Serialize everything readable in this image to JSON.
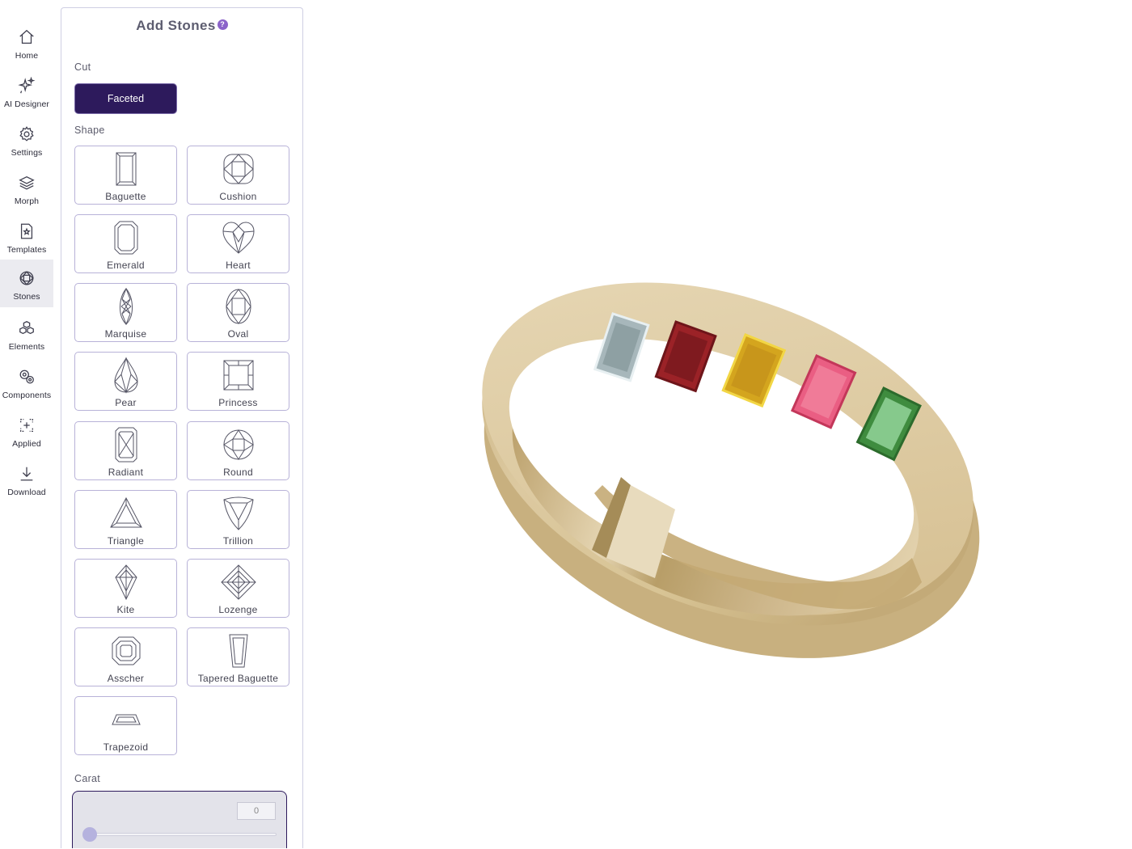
{
  "nav": {
    "items": [
      {
        "label": "Home",
        "icon": "home-icon"
      },
      {
        "label": "AI Designer",
        "icon": "sparkles-icon"
      },
      {
        "label": "Settings",
        "icon": "gear-icon"
      },
      {
        "label": "Morph",
        "icon": "layers-icon"
      },
      {
        "label": "Templates",
        "icon": "template-icon"
      },
      {
        "label": "Stones",
        "icon": "gem-icon",
        "active": true
      },
      {
        "label": "Elements",
        "icon": "elements-icon"
      },
      {
        "label": "Components",
        "icon": "components-icon"
      },
      {
        "label": "Applied",
        "icon": "applied-icon"
      },
      {
        "label": "Download",
        "icon": "download-icon"
      }
    ]
  },
  "panel": {
    "title": "Add Stones",
    "help": "?",
    "cut_label": "Cut",
    "cut_value": "Faceted",
    "shape_label": "Shape",
    "shapes": [
      {
        "label": "Baguette",
        "icon": "baguette-icon"
      },
      {
        "label": "Cushion",
        "icon": "cushion-icon"
      },
      {
        "label": "Emerald",
        "icon": "emerald-icon"
      },
      {
        "label": "Heart",
        "icon": "heart-icon"
      },
      {
        "label": "Marquise",
        "icon": "marquise-icon"
      },
      {
        "label": "Oval",
        "icon": "oval-icon"
      },
      {
        "label": "Pear",
        "icon": "pear-icon"
      },
      {
        "label": "Princess",
        "icon": "princess-icon"
      },
      {
        "label": "Radiant",
        "icon": "radiant-icon"
      },
      {
        "label": "Round",
        "icon": "round-icon"
      },
      {
        "label": "Triangle",
        "icon": "triangle-icon"
      },
      {
        "label": "Trillion",
        "icon": "trillion-icon"
      },
      {
        "label": "Kite",
        "icon": "kite-icon"
      },
      {
        "label": "Lozenge",
        "icon": "lozenge-icon"
      },
      {
        "label": "Asscher",
        "icon": "asscher-icon"
      },
      {
        "label": "Tapered Baguette",
        "icon": "tapered-baguette-icon"
      },
      {
        "label": "Trapezoid",
        "icon": "trapezoid-icon"
      }
    ],
    "carat_label": "Carat",
    "carat_value": "0",
    "carat_fraction": 0
  },
  "colors": {
    "accent": "#2d1a5c",
    "help": "#8b63c9",
    "gold": "#d8c395"
  }
}
